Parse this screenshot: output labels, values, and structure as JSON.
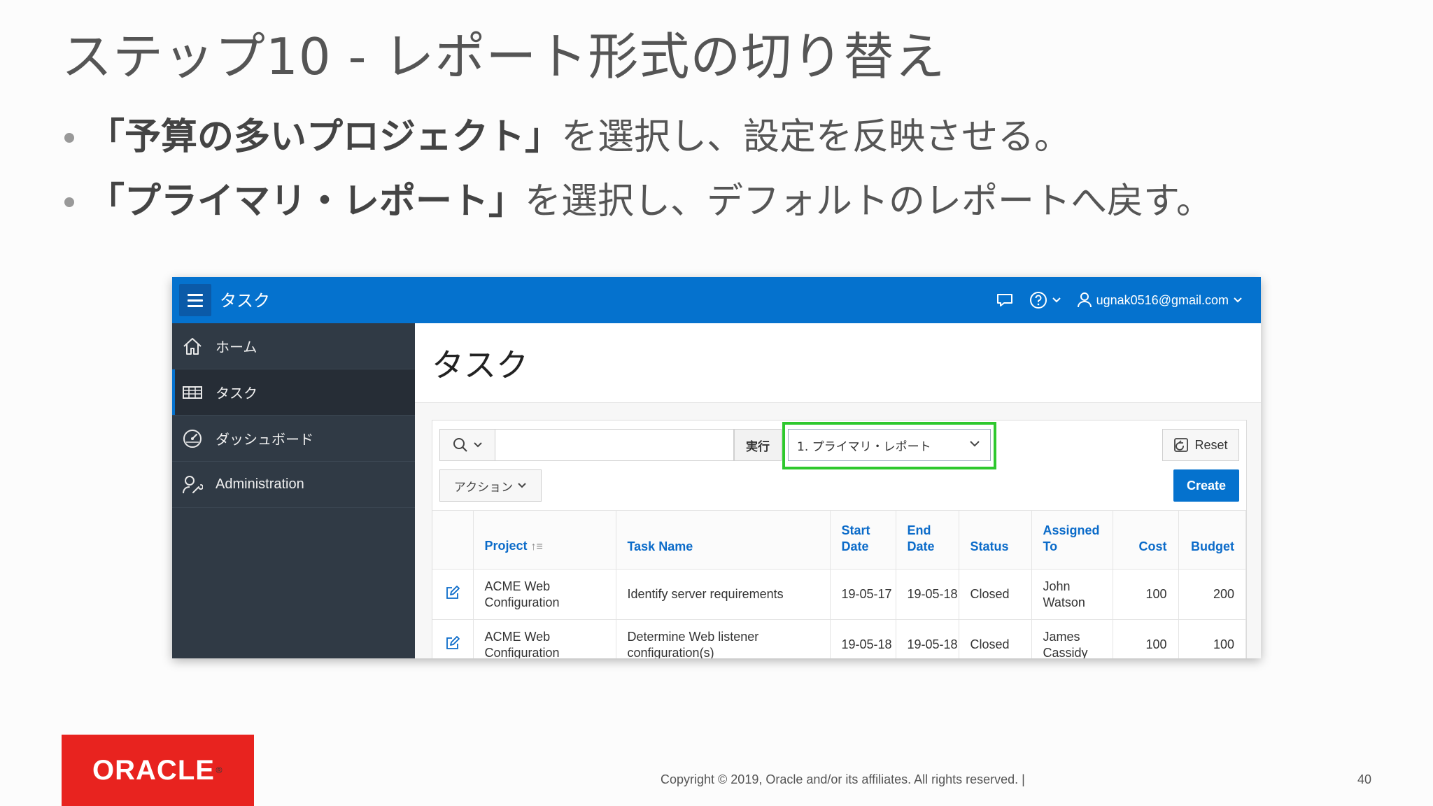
{
  "slide": {
    "title": "ステップ10 - レポート形式の切り替え",
    "bullets": [
      {
        "bold": "「予算の多いプロジェクト」",
        "rest": "を選択し、設定を反映させる。"
      },
      {
        "bold": "「プライマリ・レポート」",
        "rest": "を選択し、デフォルトのレポートへ戻す。"
      }
    ],
    "copyright": "Copyright © 2019, Oracle and/or its affiliates. All rights reserved.  |",
    "page_number": "40",
    "logo_text": "ORACLE"
  },
  "app": {
    "header": {
      "title": "タスク",
      "user": "ugnak0516@gmail.com"
    },
    "sidebar": {
      "items": [
        {
          "label": "ホーム",
          "icon": "home-icon"
        },
        {
          "label": "タスク",
          "icon": "table-icon"
        },
        {
          "label": "ダッシュボード",
          "icon": "dashboard-icon"
        },
        {
          "label": "Administration",
          "icon": "user-wrench-icon"
        }
      ]
    },
    "page_title": "タスク",
    "toolbar": {
      "go_label": "実行",
      "report_selected": "1. プライマリ・レポート",
      "reset_label": "Reset",
      "actions_label": "アクション",
      "create_label": "Create"
    },
    "table": {
      "columns": [
        "",
        "Project",
        "Task Name",
        "Start Date",
        "End Date",
        "Status",
        "Assigned To",
        "Cost",
        "Budget"
      ],
      "rows": [
        {
          "project": "ACME Web Configuration",
          "task": "Identify server requirements",
          "start": "19-05-17",
          "end": "19-05-18",
          "status": "Closed",
          "assigned": "John Watson",
          "cost": "100",
          "budget": "200"
        },
        {
          "project": "ACME Web Configuration",
          "task": "Determine Web listener configuration(s)",
          "start": "19-05-18",
          "end": "19-05-18",
          "status": "Closed",
          "assigned": "James Cassidy",
          "cost": "100",
          "budget": "100"
        }
      ]
    }
  },
  "colors": {
    "accent": "#0572ce",
    "sidebar": "#303a45",
    "highlight": "#2ec82e",
    "oracle_red": "#e8231f"
  }
}
